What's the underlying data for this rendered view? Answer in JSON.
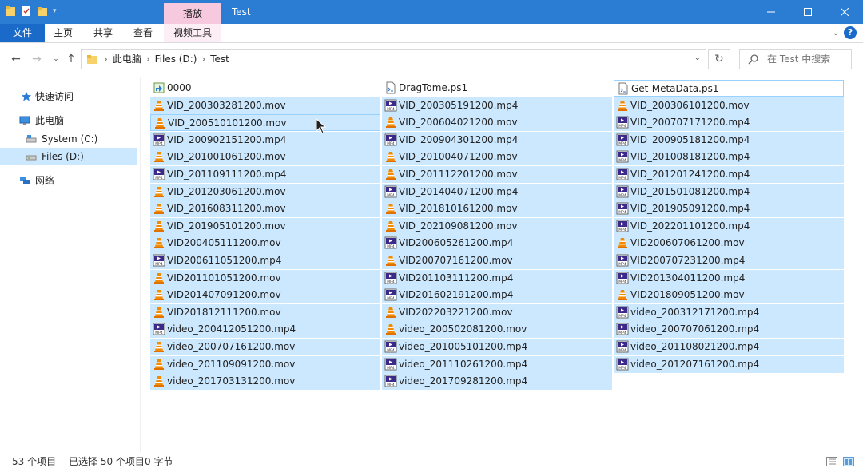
{
  "titlebar": {
    "title": "Test",
    "context_tab": "播放",
    "accent": "#2b7cd3",
    "context_color": "#f6c9df"
  },
  "ribbon": {
    "tabs": [
      "文件",
      "主页",
      "共享",
      "查看",
      "视频工具"
    ]
  },
  "address": {
    "crumbs": [
      "此电脑",
      "Files (D:)",
      "Test"
    ]
  },
  "search": {
    "placeholder": "在 Test 中搜索"
  },
  "sidebar": {
    "items": [
      {
        "label": "快速访问",
        "icon": "star-icon"
      },
      {
        "label": "此电脑",
        "icon": "computer-icon"
      },
      {
        "label": "System (C:)",
        "icon": "drive-icon"
      },
      {
        "label": "Files (D:)",
        "icon": "drive-icon"
      },
      {
        "label": "网络",
        "icon": "network-icon"
      }
    ]
  },
  "files": [
    {
      "name": "0000",
      "type": "shortcut"
    },
    {
      "name": "DragTome.ps1",
      "type": "ps1"
    },
    {
      "name": "Get-MetaData.ps1",
      "type": "ps1"
    },
    {
      "name": "VID_200303281200.mov",
      "type": "mov"
    },
    {
      "name": "VID_200305191200.mp4",
      "type": "mp4"
    },
    {
      "name": "VID_200306101200.mov",
      "type": "mov"
    },
    {
      "name": "VID_200510101200.mov",
      "type": "mov"
    },
    {
      "name": "VID_200604021200.mov",
      "type": "mov"
    },
    {
      "name": "VID_200707171200.mp4",
      "type": "mp4"
    },
    {
      "name": "VID_200902151200.mp4",
      "type": "mp4"
    },
    {
      "name": "VID_200904301200.mp4",
      "type": "mp4"
    },
    {
      "name": "VID_200905181200.mp4",
      "type": "mp4"
    },
    {
      "name": "VID_201001061200.mov",
      "type": "mov"
    },
    {
      "name": "VID_201004071200.mov",
      "type": "mov"
    },
    {
      "name": "VID_201008181200.mp4",
      "type": "mp4"
    },
    {
      "name": "VID_201109111200.mp4",
      "type": "mp4"
    },
    {
      "name": "VID_201112201200.mov",
      "type": "mov"
    },
    {
      "name": "VID_201201241200.mp4",
      "type": "mp4"
    },
    {
      "name": "VID_201203061200.mov",
      "type": "mov"
    },
    {
      "name": "VID_201404071200.mp4",
      "type": "mp4"
    },
    {
      "name": "VID_201501081200.mp4",
      "type": "mp4"
    },
    {
      "name": "VID_201608311200.mov",
      "type": "mov"
    },
    {
      "name": "VID_201810161200.mov",
      "type": "mov"
    },
    {
      "name": "VID_201905091200.mp4",
      "type": "mp4"
    },
    {
      "name": "VID_201905101200.mov",
      "type": "mov"
    },
    {
      "name": "VID_202109081200.mov",
      "type": "mov"
    },
    {
      "name": "VID_202201101200.mp4",
      "type": "mp4"
    },
    {
      "name": "VID200405111200.mov",
      "type": "mov"
    },
    {
      "name": "VID200605261200.mp4",
      "type": "mp4"
    },
    {
      "name": "VID200607061200.mov",
      "type": "mov"
    },
    {
      "name": "VID200611051200.mp4",
      "type": "mp4"
    },
    {
      "name": "VID200707161200.mov",
      "type": "mov"
    },
    {
      "name": "VID200707231200.mp4",
      "type": "mp4"
    },
    {
      "name": "VID201101051200.mov",
      "type": "mov"
    },
    {
      "name": "VID201103111200.mp4",
      "type": "mp4"
    },
    {
      "name": "VID201304011200.mp4",
      "type": "mp4"
    },
    {
      "name": "VID201407091200.mov",
      "type": "mov"
    },
    {
      "name": "VID201602191200.mp4",
      "type": "mp4"
    },
    {
      "name": "VID201809051200.mov",
      "type": "mov"
    },
    {
      "name": "VID201812111200.mov",
      "type": "mov"
    },
    {
      "name": "VID202203221200.mov",
      "type": "mov"
    },
    {
      "name": "video_200312171200.mp4",
      "type": "mp4"
    },
    {
      "name": "video_200412051200.mp4",
      "type": "mp4"
    },
    {
      "name": "video_200502081200.mov",
      "type": "mov"
    },
    {
      "name": "video_200707061200.mp4",
      "type": "mp4"
    },
    {
      "name": "video_200707161200.mov",
      "type": "mov"
    },
    {
      "name": "video_201005101200.mp4",
      "type": "mp4"
    },
    {
      "name": "video_201108021200.mp4",
      "type": "mp4"
    },
    {
      "name": "video_201109091200.mov",
      "type": "mov"
    },
    {
      "name": "video_201110261200.mp4",
      "type": "mp4"
    },
    {
      "name": "video_201207161200.mp4",
      "type": "mp4"
    },
    {
      "name": "video_201703131200.mov",
      "type": "mov"
    },
    {
      "name": "video_201709281200.mp4",
      "type": "mp4"
    }
  ],
  "status": {
    "count": "53 个项目",
    "selected": "已选择 50 个项目",
    "size": "0 字节"
  },
  "colors": {
    "selection": "#cce8ff",
    "selection_border": "#99d1ff",
    "vlc_orange": "#f28b00",
    "mp4_purple": "#3b2a8a"
  }
}
